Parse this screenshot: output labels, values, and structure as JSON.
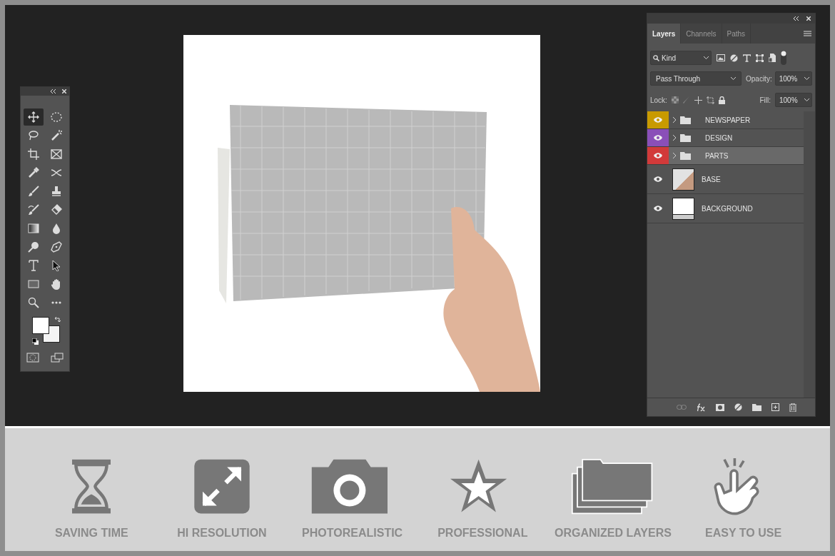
{
  "toolbar": {
    "tools": [
      {
        "kind": "move",
        "selected": true
      },
      {
        "kind": "marquee",
        "selected": false
      },
      {
        "kind": "lasso",
        "selected": false
      },
      {
        "kind": "wand",
        "selected": false
      },
      {
        "kind": "crop",
        "selected": false
      },
      {
        "kind": "frame",
        "selected": false
      },
      {
        "kind": "eyedropper",
        "selected": false
      },
      {
        "kind": "content-aware",
        "selected": false
      },
      {
        "kind": "brush",
        "selected": false
      },
      {
        "kind": "stamp",
        "selected": false
      },
      {
        "kind": "history-brush",
        "selected": false
      },
      {
        "kind": "eraser",
        "selected": false
      },
      {
        "kind": "gradient",
        "selected": false
      },
      {
        "kind": "blur",
        "selected": false
      },
      {
        "kind": "dodge",
        "selected": false
      },
      {
        "kind": "pen",
        "selected": false
      },
      {
        "kind": "type",
        "selected": false
      },
      {
        "kind": "select",
        "selected": false
      },
      {
        "kind": "rectangle",
        "selected": false
      },
      {
        "kind": "hand",
        "selected": false
      },
      {
        "kind": "zoom",
        "selected": false
      },
      {
        "kind": "more",
        "selected": false
      }
    ]
  },
  "layers_panel": {
    "tabs": [
      {
        "label": "Layers",
        "selected": true
      },
      {
        "label": "Channels",
        "selected": false
      },
      {
        "label": "Paths",
        "selected": false
      }
    ],
    "filter": {
      "value": "Kind"
    },
    "blend_mode": {
      "value": "Pass Through"
    },
    "opacity": {
      "label": "Opacity:",
      "value": "100%"
    },
    "lock": {
      "label": "Lock:"
    },
    "fill": {
      "label": "Fill:",
      "value": "100%"
    },
    "layers": [
      {
        "name": "NEWSPAPER",
        "kind": "group",
        "color": "#c89a00",
        "selected": false
      },
      {
        "name": "DESIGN",
        "kind": "group",
        "color": "#8a4fb8",
        "selected": false
      },
      {
        "name": "PARTS",
        "kind": "group",
        "color": "#d23a3a",
        "selected": true
      },
      {
        "name": "BASE",
        "kind": "photo",
        "selected": false
      },
      {
        "name": "BACKGROUND",
        "kind": "background",
        "selected": false
      }
    ]
  },
  "features": [
    {
      "kind": "hourglass",
      "label": "SAVING TIME"
    },
    {
      "kind": "expand",
      "label": "HI RESOLUTION"
    },
    {
      "kind": "camera",
      "label": "PHOTOREALISTIC"
    },
    {
      "kind": "star",
      "label": "PROFESSIONAL"
    },
    {
      "kind": "folders",
      "label": "ORGANIZED LAYERS"
    },
    {
      "kind": "tap",
      "label": "EASY TO USE"
    }
  ]
}
